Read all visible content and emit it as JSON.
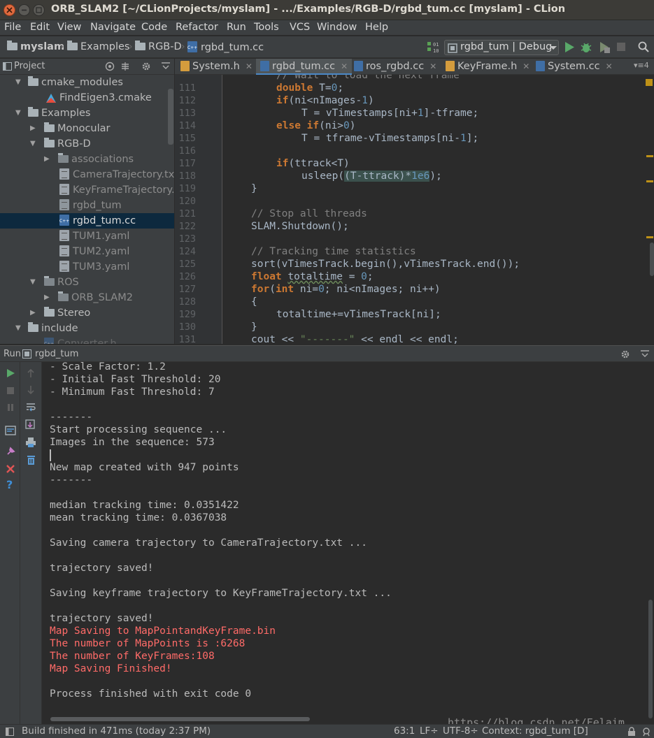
{
  "window": {
    "title": "ORB_SLAM2 [~/CLionProjects/myslam] - .../Examples/RGB-D/rgbd_tum.cc [myslam] - CLion"
  },
  "menu": {
    "items": [
      "File",
      "Edit",
      "View",
      "Navigate",
      "Code",
      "Refactor",
      "Run",
      "Tools",
      "VCS",
      "Window",
      "Help"
    ]
  },
  "breadcrumb": {
    "items": [
      "myslam",
      "Examples",
      "RGB-D",
      "rgbd_tum.cc"
    ]
  },
  "run_config": {
    "label": "rgbd_tum | Debug"
  },
  "project_panel": {
    "title": "Project"
  },
  "tree": {
    "cmake_modules": "cmake_modules",
    "findeigen": "FindEigen3.cmake",
    "examples": "Examples",
    "monocular": "Monocular",
    "rgbd": "RGB-D",
    "associations": "associations",
    "camtraj": "CameraTrajectory.txt",
    "kftraj": "KeyFrameTrajectory.txt",
    "rgbd_tum": "rgbd_tum",
    "rgbd_tum_cc": "rgbd_tum.cc",
    "tum1": "TUM1.yaml",
    "tum2": "TUM2.yaml",
    "tum3": "TUM3.yaml",
    "ros": "ROS",
    "orb_slam2": "ORB_SLAM2",
    "stereo": "Stereo",
    "include": "include",
    "converter": "Converter.h"
  },
  "tabs": [
    {
      "label": "System.h",
      "icon": "header-file-icon"
    },
    {
      "label": "rgbd_tum.cc",
      "icon": "cpp-file-icon",
      "active": true
    },
    {
      "label": "ros_rgbd.cc",
      "icon": "cpp-file-icon"
    },
    {
      "label": "KeyFrame.h",
      "icon": "header-file-icon"
    },
    {
      "label": "System.cc",
      "icon": "cpp-file-icon"
    }
  ],
  "tabs_overflow": "4",
  "editor": {
    "line_numbers": [
      "111",
      "112",
      "113",
      "114",
      "115",
      "116",
      "117",
      "118",
      "119",
      "120",
      "121",
      "122",
      "123",
      "124",
      "125",
      "126",
      "127",
      "128",
      "129",
      "130",
      "131"
    ],
    "partial_top": "// Wait to load the next frame"
  },
  "run_panel": {
    "label": "Run",
    "config": "rgbd_tum"
  },
  "console": {
    "lines": [
      {
        "text": "- Scale Factor: 1.2",
        "type": "normal"
      },
      {
        "text": "- Initial Fast Threshold: 20",
        "type": "normal"
      },
      {
        "text": "- Minimum Fast Threshold: 7",
        "type": "normal"
      },
      {
        "text": "",
        "type": "normal"
      },
      {
        "text": "-------",
        "type": "normal"
      },
      {
        "text": "Start processing sequence ...",
        "type": "normal"
      },
      {
        "text": "Images in the sequence: 573",
        "type": "normal"
      },
      {
        "text": "",
        "type": "normal"
      },
      {
        "text": "New map created with 947 points",
        "type": "normal"
      },
      {
        "text": "-------",
        "type": "normal"
      },
      {
        "text": "",
        "type": "normal"
      },
      {
        "text": "median tracking time: 0.0351422",
        "type": "normal"
      },
      {
        "text": "mean tracking time: 0.0367038",
        "type": "normal"
      },
      {
        "text": "",
        "type": "normal"
      },
      {
        "text": "Saving camera trajectory to CameraTrajectory.txt ...",
        "type": "normal"
      },
      {
        "text": "",
        "type": "normal"
      },
      {
        "text": "trajectory saved!",
        "type": "normal"
      },
      {
        "text": "",
        "type": "normal"
      },
      {
        "text": "Saving keyframe trajectory to KeyFrameTrajectory.txt ...",
        "type": "normal"
      },
      {
        "text": "",
        "type": "normal"
      },
      {
        "text": "trajectory saved!",
        "type": "normal"
      },
      {
        "text": "Map Saving to MapPointandKeyFrame.bin",
        "type": "error"
      },
      {
        "text": "The number of MapPoints is :6268",
        "type": "error"
      },
      {
        "text": "The number of KeyFrames:108",
        "type": "error"
      },
      {
        "text": "Map Saving Finished!",
        "type": "error"
      },
      {
        "text": "",
        "type": "normal"
      },
      {
        "text": "Process finished with exit code 0",
        "type": "normal"
      }
    ]
  },
  "status": {
    "message": "Build finished in 471ms (today 2:37 PM)",
    "position": "63:1",
    "line_sep": "LF÷",
    "encoding": "UTF-8÷",
    "context": "Context: rgbd_tum [D]"
  },
  "watermark": "https://blog.csdn.net/Felaim",
  "colors": {
    "keyword": "#cc7832",
    "number": "#6897bb",
    "comment": "#808080",
    "string": "#6a8759",
    "error_output": "#ff6b68",
    "selection": "#0d293e",
    "accent": "#4a88c7"
  }
}
